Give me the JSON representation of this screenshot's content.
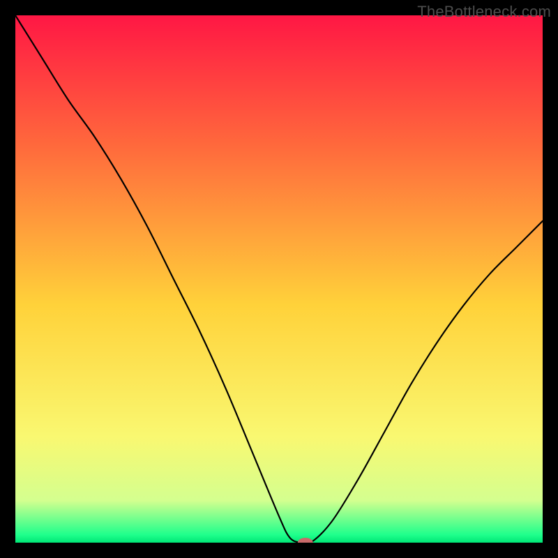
{
  "watermark": "TheBottleneck.com",
  "chart_data": {
    "type": "line",
    "title": "",
    "xlabel": "",
    "ylabel": "",
    "xlim": [
      0,
      100
    ],
    "ylim": [
      0,
      100
    ],
    "grid": false,
    "legend": false,
    "background_gradient": {
      "stops": [
        {
          "offset": 0.0,
          "color": "#ff1744"
        },
        {
          "offset": 0.25,
          "color": "#ff6a3c"
        },
        {
          "offset": 0.55,
          "color": "#ffd23a"
        },
        {
          "offset": 0.8,
          "color": "#f9f871"
        },
        {
          "offset": 0.92,
          "color": "#d4ff8f"
        },
        {
          "offset": 0.985,
          "color": "#1fff8c"
        },
        {
          "offset": 1.0,
          "color": "#00e676"
        }
      ]
    },
    "series": [
      {
        "name": "bottleneck-curve",
        "color": "#000000",
        "x": [
          0,
          5,
          10,
          15,
          20,
          25,
          30,
          35,
          40,
          45,
          50,
          52,
          54,
          56,
          60,
          65,
          70,
          75,
          80,
          85,
          90,
          95,
          100
        ],
        "y": [
          100,
          92,
          84,
          77,
          69,
          60,
          50,
          40,
          29,
          17,
          5,
          1,
          0,
          0,
          4,
          12,
          21,
          30,
          38,
          45,
          51,
          56,
          61
        ]
      }
    ],
    "marker": {
      "name": "optimal-point",
      "x": 55,
      "y": 0,
      "color": "#c96a6a",
      "rx": 11,
      "ry": 7
    }
  }
}
